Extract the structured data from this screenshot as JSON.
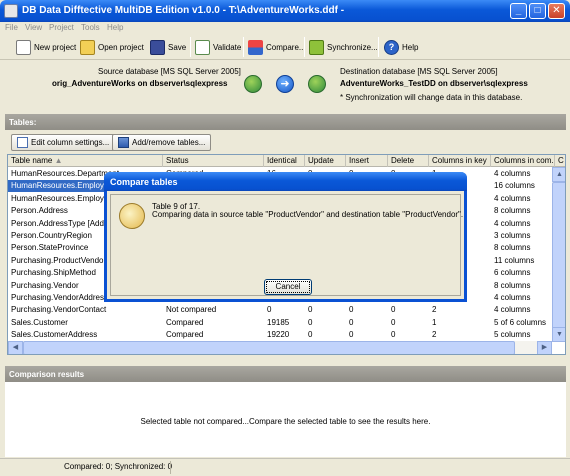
{
  "window": {
    "title": "DB Data Difftective MultiDB Edition v1.0.0 - T:\\AdventureWorks.ddf -"
  },
  "menu": [
    "File",
    "View",
    "Project",
    "Tools",
    "Help"
  ],
  "toolbar": {
    "new_project": "New project",
    "open_project": "Open project",
    "save": "Save",
    "validate": "Validate",
    "compare": "Compare...",
    "synchronize": "Synchronize...",
    "help": "Help"
  },
  "source": {
    "label": "Source database [MS SQL Server 2005]",
    "name": "orig_AdventureWorks on dbserver\\sqlexpress"
  },
  "destination": {
    "label": "Destination database [MS SQL Server 2005]",
    "name": "AdventureWorks_TestDD on dbserver\\sqlexpress",
    "note": "* Synchronization will change data in this database."
  },
  "tables_section": {
    "title": "Tables:",
    "edit_columns": "Edit column settings...",
    "add_remove": "Add/remove tables..."
  },
  "columns": [
    "Table name",
    "Status",
    "Identical",
    "Update",
    "Insert",
    "Delete",
    "Columns in key",
    "Columns in com...",
    "C"
  ],
  "rows": [
    [
      "HumanResources.Department",
      "Compared",
      "16",
      "0",
      "0",
      "0",
      "1",
      "4 columns"
    ],
    [
      "HumanResources.Employee",
      "",
      "",
      "",
      "",
      "",
      "",
      "16 columns"
    ],
    [
      "HumanResources.EmployeeAddress",
      "",
      "",
      "",
      "",
      "",
      "",
      "4 columns"
    ],
    [
      "Person.Address",
      "",
      "",
      "",
      "",
      "",
      "",
      "8 columns"
    ],
    [
      "Person.AddressType  [Address]",
      "",
      "",
      "",
      "",
      "",
      "",
      "4 columns"
    ],
    [
      "Person.CountryRegion",
      "",
      "",
      "",
      "",
      "",
      "",
      "3 columns"
    ],
    [
      "Person.StateProvince",
      "",
      "",
      "",
      "",
      "",
      "",
      "8 columns"
    ],
    [
      "Purchasing.ProductVendor",
      "",
      "",
      "",
      "",
      "",
      "",
      "11 columns"
    ],
    [
      "Purchasing.ShipMethod",
      "",
      "",
      "",
      "",
      "",
      "",
      "6 columns"
    ],
    [
      "Purchasing.Vendor",
      "",
      "",
      "",
      "",
      "",
      "",
      "8 columns"
    ],
    [
      "Purchasing.VendorAddress",
      "",
      "",
      "",
      "",
      "",
      "",
      "4 columns"
    ],
    [
      "Purchasing.VendorContact",
      "Not compared",
      "0",
      "0",
      "0",
      "0",
      "2",
      "4 columns"
    ],
    [
      "Sales.Customer",
      "Compared",
      "19185",
      "0",
      "0",
      "0",
      "1",
      "5 of 6 columns"
    ],
    [
      "Sales.CustomerAddress",
      "Compared",
      "19220",
      "0",
      "0",
      "0",
      "2",
      "5 columns"
    ]
  ],
  "results": {
    "title": "Comparison results",
    "message": "Selected table not compared...Compare the selected table to see the results here."
  },
  "status": {
    "text": "Compared: 0; Synchronized: 0"
  },
  "dialog": {
    "title": "Compare tables",
    "line1": "Table 9 of 17.",
    "line2": "Comparing data in source table \"ProductVendor\" and destination table \"ProductVendor\".",
    "cancel": "Cancel"
  }
}
